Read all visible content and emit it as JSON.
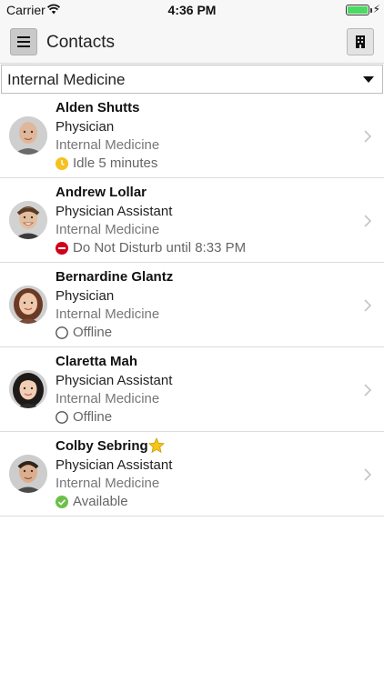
{
  "status_bar": {
    "carrier": "Carrier",
    "time": "4:36 PM"
  },
  "nav": {
    "title": "Contacts"
  },
  "department_select": {
    "value": "Internal Medicine"
  },
  "contacts": [
    {
      "name": "Alden Shutts",
      "title": "Physician",
      "department": "Internal Medicine",
      "status": "Idle 5 minutes",
      "status_kind": "idle",
      "favorite": false
    },
    {
      "name": "Andrew Lollar",
      "title": "Physician Assistant",
      "department": "Internal Medicine",
      "status": "Do Not Disturb until 8:33 PM",
      "status_kind": "dnd",
      "favorite": false
    },
    {
      "name": "Bernardine Glantz",
      "title": "Physician",
      "department": "Internal Medicine",
      "status": "Offline",
      "status_kind": "offline",
      "favorite": false
    },
    {
      "name": "Claretta Mah",
      "title": "Physician Assistant",
      "department": "Internal Medicine",
      "status": "Offline",
      "status_kind": "offline",
      "favorite": false
    },
    {
      "name": "Colby Sebring",
      "title": "Physician Assistant",
      "department": "Internal Medicine",
      "status": "Available",
      "status_kind": "available",
      "favorite": true
    }
  ],
  "colors": {
    "idle": "#f5c11d",
    "dnd": "#d0021b",
    "available": "#6cc04a",
    "offline": "#555555",
    "battery": "#4cd964",
    "star": "#f5c518"
  }
}
